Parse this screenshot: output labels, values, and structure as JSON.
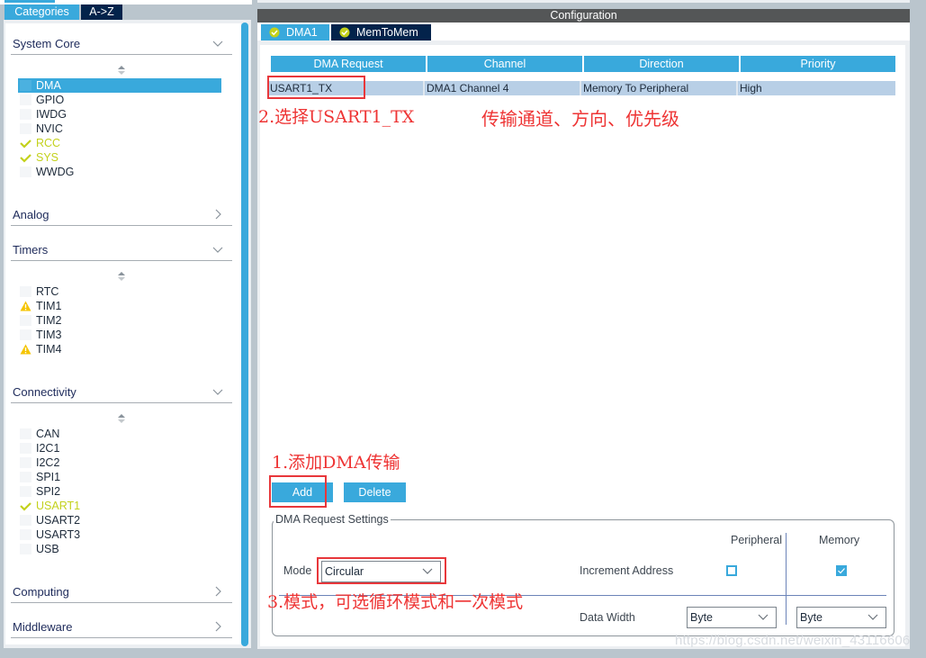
{
  "sidebar": {
    "tabs": [
      {
        "label": "Categories",
        "active": true
      },
      {
        "label": "A->Z",
        "active": false
      }
    ],
    "sections": [
      {
        "title": "System Core",
        "expanded": true,
        "items": [
          {
            "label": "DMA",
            "status": "selected"
          },
          {
            "label": "GPIO",
            "status": "none"
          },
          {
            "label": "IWDG",
            "status": "none"
          },
          {
            "label": "NVIC",
            "status": "none"
          },
          {
            "label": "RCC",
            "status": "ok"
          },
          {
            "label": "SYS",
            "status": "ok"
          },
          {
            "label": "WWDG",
            "status": "none"
          }
        ]
      },
      {
        "title": "Analog",
        "expanded": false,
        "items": []
      },
      {
        "title": "Timers",
        "expanded": true,
        "items": [
          {
            "label": "RTC",
            "status": "none"
          },
          {
            "label": "TIM1",
            "status": "warning"
          },
          {
            "label": "TIM2",
            "status": "none"
          },
          {
            "label": "TIM3",
            "status": "none"
          },
          {
            "label": "TIM4",
            "status": "warning"
          }
        ]
      },
      {
        "title": "Connectivity",
        "expanded": true,
        "items": [
          {
            "label": "CAN",
            "status": "none"
          },
          {
            "label": "I2C1",
            "status": "none"
          },
          {
            "label": "I2C2",
            "status": "none"
          },
          {
            "label": "SPI1",
            "status": "none"
          },
          {
            "label": "SPI2",
            "status": "none"
          },
          {
            "label": "USART1",
            "status": "ok"
          },
          {
            "label": "USART2",
            "status": "none"
          },
          {
            "label": "USART3",
            "status": "none"
          },
          {
            "label": "USB",
            "status": "none"
          }
        ]
      },
      {
        "title": "Computing",
        "expanded": false,
        "items": []
      },
      {
        "title": "Middleware",
        "expanded": false,
        "items": []
      }
    ]
  },
  "config": {
    "title": "Configuration",
    "tabs": [
      {
        "label": "DMA1",
        "active": true
      },
      {
        "label": "MemToMem",
        "active": false
      }
    ],
    "table": {
      "headers": [
        "DMA Request",
        "Channel",
        "Direction",
        "Priority"
      ],
      "rows": [
        [
          "USART1_TX",
          "DMA1 Channel 4",
          "Memory To Peripheral",
          "High"
        ]
      ]
    },
    "buttons": {
      "add": "Add",
      "delete": "Delete"
    },
    "settings": {
      "legend": "DMA Request Settings",
      "mode_label": "Mode",
      "mode_value": "Circular",
      "col_peripheral": "Peripheral",
      "col_memory": "Memory",
      "increment_label": "Increment Address",
      "peripheral_increment": false,
      "memory_increment": true,
      "data_width_label": "Data Width",
      "peripheral_width": "Byte",
      "memory_width": "Byte"
    }
  },
  "annotations": {
    "step1": "1.添加DMA传输",
    "step2": "2.选择USART1_TX",
    "note": "传输通道、方向、优先级",
    "step3": "3.模式，可选循环模式和一次模式"
  },
  "watermark": "https://blog.csdn.net/weixin_43116606",
  "colors": {
    "accent": "#39a9dc",
    "dark_tab": "#03234b",
    "ok_green": "#c3d11b",
    "warning_yellow": "#f5c400",
    "annotation_red": "#ee3434",
    "row_selected": "#b8cfe6"
  }
}
